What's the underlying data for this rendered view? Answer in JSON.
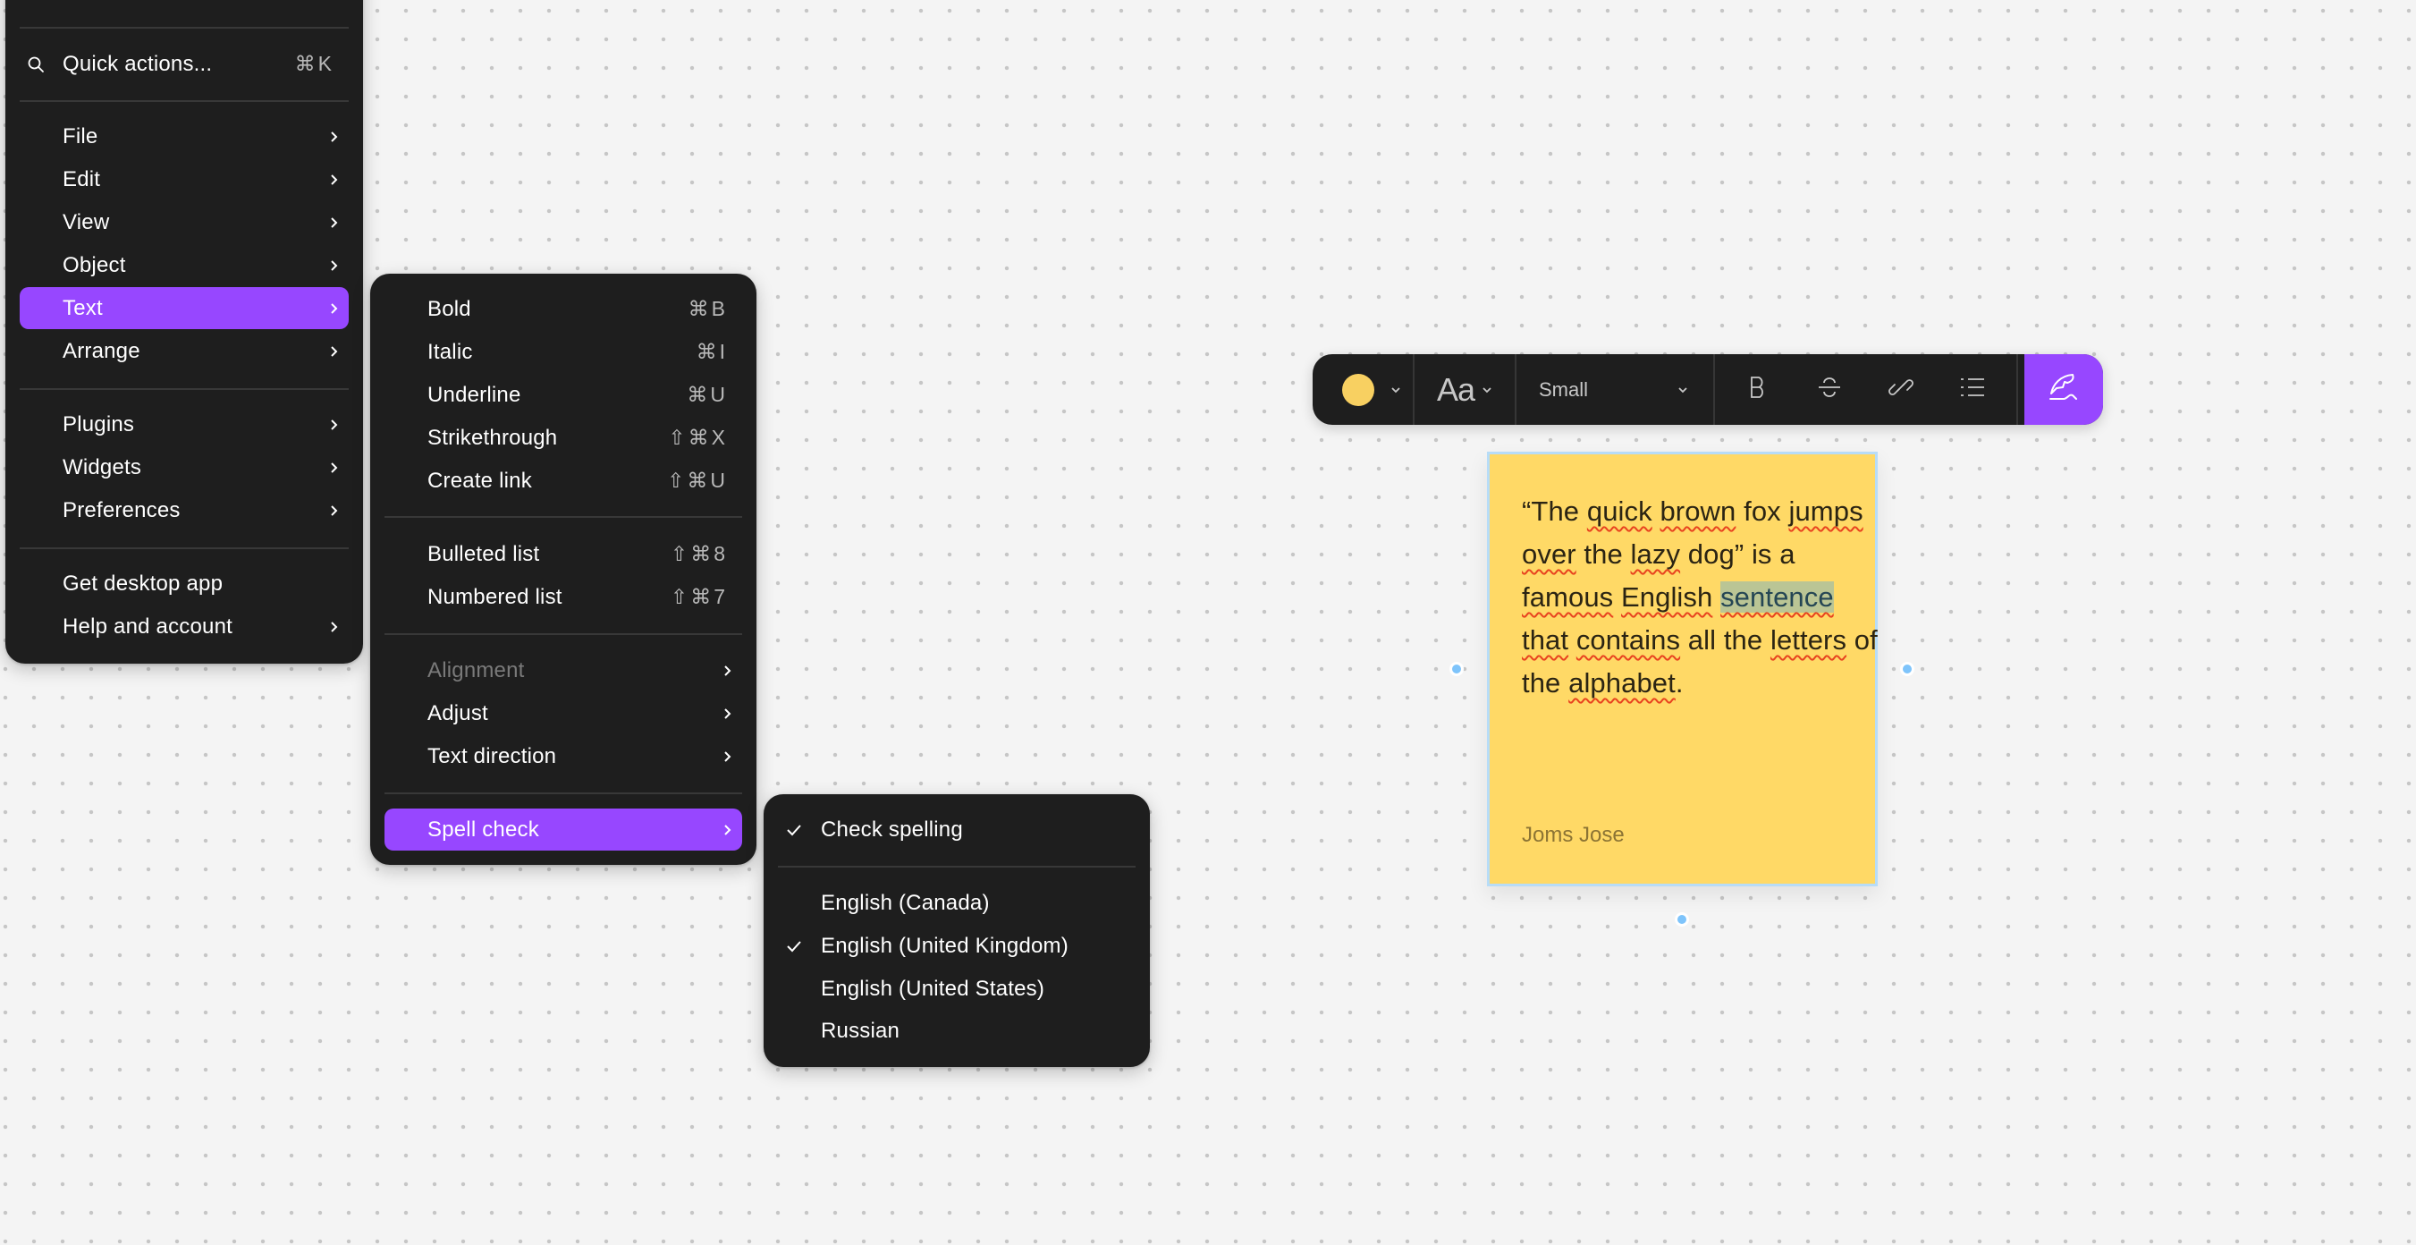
{
  "main_menu": {
    "quick_actions": {
      "label": "Quick actions...",
      "shortcut": "⌘K",
      "icon": "search-icon"
    },
    "group1": [
      {
        "label": "File",
        "has_submenu": true
      },
      {
        "label": "Edit",
        "has_submenu": true
      },
      {
        "label": "View",
        "has_submenu": true
      },
      {
        "label": "Object",
        "has_submenu": true
      },
      {
        "label": "Text",
        "has_submenu": true,
        "active": true
      },
      {
        "label": "Arrange",
        "has_submenu": true
      }
    ],
    "group2": [
      {
        "label": "Plugins",
        "has_submenu": true
      },
      {
        "label": "Widgets",
        "has_submenu": true
      },
      {
        "label": "Preferences",
        "has_submenu": true
      }
    ],
    "group3": [
      {
        "label": "Get desktop app",
        "has_submenu": false
      },
      {
        "label": "Help and account",
        "has_submenu": true
      }
    ]
  },
  "text_menu": {
    "formatting": [
      {
        "label": "Bold",
        "shortcut": "⌘B"
      },
      {
        "label": "Italic",
        "shortcut": "⌘I"
      },
      {
        "label": "Underline",
        "shortcut": "⌘U"
      },
      {
        "label": "Strikethrough",
        "shortcut": "⇧⌘X"
      },
      {
        "label": "Create link",
        "shortcut": "⇧⌘U"
      }
    ],
    "lists": [
      {
        "label": "Bulleted list",
        "shortcut": "⇧⌘8"
      },
      {
        "label": "Numbered list",
        "shortcut": "⇧⌘7"
      }
    ],
    "layout": [
      {
        "label": "Alignment",
        "has_submenu": true,
        "disabled": true
      },
      {
        "label": "Adjust",
        "has_submenu": true
      },
      {
        "label": "Text direction",
        "has_submenu": true
      }
    ],
    "spell_check": {
      "label": "Spell check",
      "has_submenu": true,
      "active": true
    }
  },
  "spell_menu": {
    "check_spelling": {
      "label": "Check spelling",
      "checked": true
    },
    "languages": [
      {
        "label": "English (Canada)",
        "checked": false
      },
      {
        "label": "English (United Kingdom)",
        "checked": true
      },
      {
        "label": "English (United States)",
        "checked": false
      },
      {
        "label": "Russian",
        "checked": false
      }
    ]
  },
  "toolbar": {
    "color": {
      "value": "#f8d061",
      "icon": "color-swatch"
    },
    "font_icon_label": "Aa",
    "size": "Small",
    "buttons": [
      "bold-icon",
      "strikethrough-icon",
      "link-icon",
      "bulleted-list-icon"
    ],
    "signature_icon": "quill-pen-icon"
  },
  "sticky_note": {
    "text_segments": [
      {
        "text": "“The ",
        "misspelled": false
      },
      {
        "text": "quick",
        "misspelled": true
      },
      {
        "text": " ",
        "misspelled": false
      },
      {
        "text": "brown",
        "misspelled": true
      },
      {
        "text": " fox ",
        "misspelled": false
      },
      {
        "text": "jumps",
        "misspelled": true
      },
      {
        "text": " ",
        "misspelled": false
      },
      {
        "text": "over",
        "misspelled": true
      },
      {
        "text": " the ",
        "misspelled": false
      },
      {
        "text": "lazy",
        "misspelled": true
      },
      {
        "text": " dog” is a ",
        "misspelled": false
      },
      {
        "text": "famous",
        "misspelled": true
      },
      {
        "text": " ",
        "misspelled": false
      },
      {
        "text": "English",
        "misspelled": true
      },
      {
        "text": " ",
        "misspelled": false
      },
      {
        "text": "sentence",
        "misspelled": true,
        "selected": true
      },
      {
        "text": " ",
        "misspelled": false
      },
      {
        "text": "that",
        "misspelled": true
      },
      {
        "text": " ",
        "misspelled": false
      },
      {
        "text": "contains",
        "misspelled": true
      },
      {
        "text": " all the ",
        "misspelled": false
      },
      {
        "text": "letters",
        "misspelled": true
      },
      {
        "text": " of the ",
        "misspelled": false
      },
      {
        "text": "alphabet",
        "misspelled": true
      },
      {
        "text": ".",
        "misspelled": false
      }
    ],
    "author": "Joms Jose",
    "background": "#ffd966"
  },
  "colors": {
    "accent": "#9747ff",
    "menu_bg": "#1e1e1e",
    "selection_border": "#b7dcf7",
    "handle": "#7ec4fb",
    "spell_underline": "#e8431f"
  }
}
